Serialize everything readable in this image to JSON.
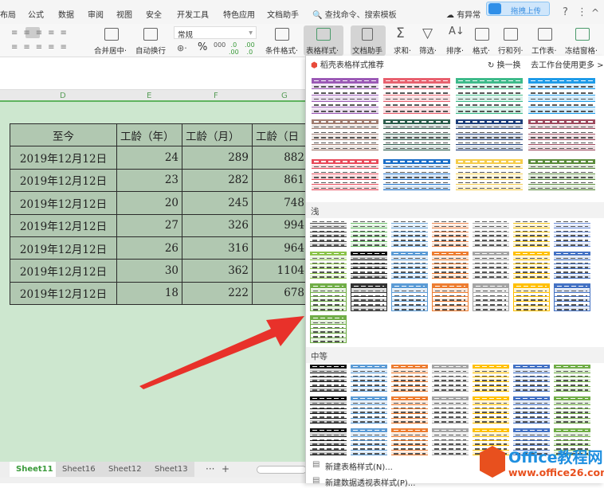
{
  "ribbon_tabs": [
    "布局",
    "公式",
    "数据",
    "审阅",
    "视图",
    "安全",
    "开发工具",
    "特色应用",
    "文档助手"
  ],
  "search": "查找命令、搜索模板",
  "status_right": {
    "sync": "有异常",
    "help": "?",
    "more": "⋮",
    "collapse": "^"
  },
  "upload_label": "拖拽上传",
  "toolbar": {
    "merge": "合并居中·",
    "wrap": "自动换行",
    "number_format": "常规",
    "percent": "%",
    "cond_format": "条件格式·",
    "table_style": "表格样式·",
    "doc_helper": "文档助手",
    "sum": "求和·",
    "filter": "筛选·",
    "sort": "排序·",
    "format": "格式·",
    "rowcol": "行和列·",
    "worksheet": "工作表·",
    "freeze": "冻结窗格·"
  },
  "columns": [
    "D",
    "E",
    "F",
    "G"
  ],
  "table": {
    "headers": [
      "至今",
      "工龄（年）",
      "工龄（月）",
      "工龄（日"
    ],
    "rows": [
      [
        "2019年12月12日",
        "24",
        "289",
        "882"
      ],
      [
        "2019年12月12日",
        "23",
        "282",
        "861"
      ],
      [
        "2019年12月12日",
        "20",
        "245",
        "748"
      ],
      [
        "2019年12月12日",
        "27",
        "326",
        "994"
      ],
      [
        "2019年12月12日",
        "26",
        "316",
        "964"
      ],
      [
        "2019年12月12日",
        "30",
        "362",
        "1104"
      ],
      [
        "2019年12月12日",
        "18",
        "222",
        "678"
      ]
    ]
  },
  "sheets": [
    {
      "name": "Sheet11",
      "active": true
    },
    {
      "name": "Sheet16"
    },
    {
      "name": "Sheet12"
    },
    {
      "name": "Sheet13"
    }
  ],
  "sheet_more": "···",
  "sheet_add": "+",
  "panel": {
    "recommend_title": "稻壳表格样式推荐",
    "refresh": "换一换",
    "more": "去工作台使用更多 >",
    "light_label": "浅",
    "medium_label": "中等",
    "new_table_style": "新建表格样式(N)...",
    "new_pivot_style": "新建数据透视表样式(P)...",
    "recommended_colors": [
      "#9b59b6",
      "#e8606e",
      "#3dba8a",
      "#1e9be8",
      "#a07c70",
      "#2e5e4e",
      "#1f3f7a",
      "#9c4a5e",
      "#e84a5a",
      "#1a6ec8",
      "#f5cc4a",
      "#5a8a3a"
    ],
    "light_colors": [
      "#444444",
      "#6abf69",
      "#6fa8dc",
      "#f08a50",
      "#aaaaaa",
      "#f5c518",
      "#6c8ed8",
      "#8bc34a",
      "#111111",
      "#5b9bd5",
      "#ed7d31",
      "#a5a5a5",
      "#ffc000",
      "#4472c4",
      "#70ad47",
      "#333333",
      "#5b9bd5",
      "#ed7d31",
      "#a5a5a5",
      "#ffc000",
      "#4472c4",
      "#70ad47"
    ],
    "medium_colors": [
      "#111111",
      "#5b9bd5",
      "#ed7d31",
      "#a5a5a5",
      "#ffc000",
      "#4472c4",
      "#70ad47"
    ]
  },
  "watermark": {
    "brand": "Office教程网",
    "url": "www.office26.com"
  },
  "arrow_color": "#e8312a"
}
